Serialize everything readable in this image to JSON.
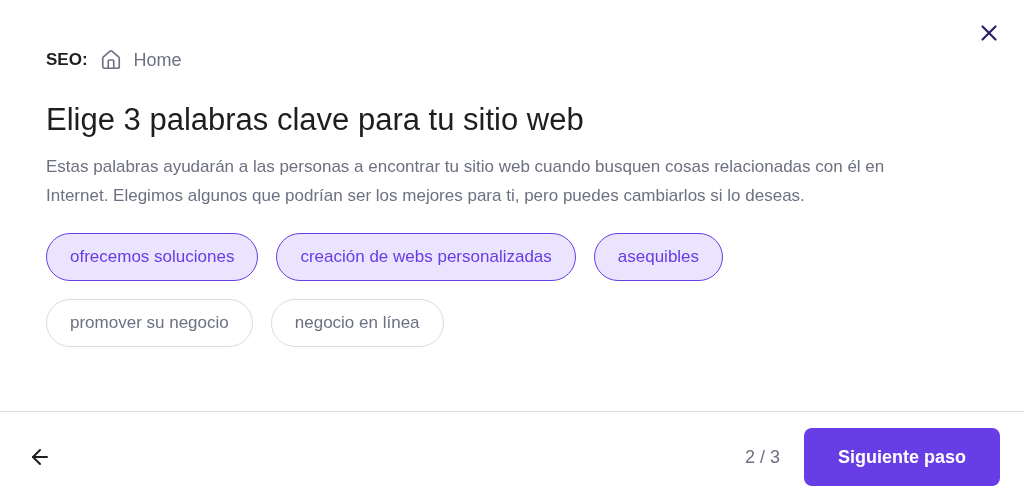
{
  "breadcrumb": {
    "label": "SEO:",
    "page": "Home"
  },
  "title": "Elige 3 palabras clave para tu sitio web",
  "description": "Estas palabras ayudarán a las personas a encontrar tu sitio web cuando busquen cosas relacionadas con él en Internet. Elegimos algunos que podrían ser los mejores para ti, pero puedes cambiarlos si lo deseas.",
  "keywords": [
    {
      "label": "ofrecemos soluciones",
      "selected": true
    },
    {
      "label": "creación de webs personalizadas",
      "selected": true
    },
    {
      "label": "asequibles",
      "selected": true
    },
    {
      "label": "promover su negocio",
      "selected": false
    },
    {
      "label": "negocio en línea",
      "selected": false
    }
  ],
  "footer": {
    "step": "2 / 3",
    "next_button": "Siguiente paso"
  }
}
